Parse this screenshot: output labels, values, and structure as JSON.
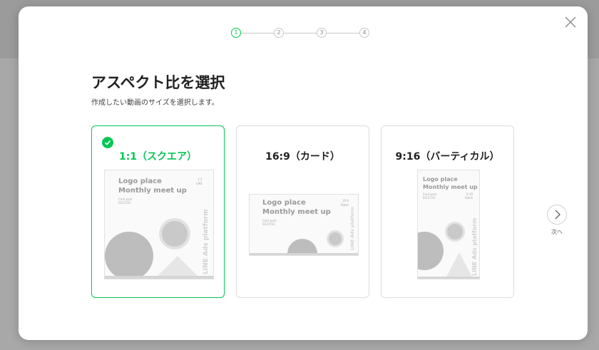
{
  "dialog": {
    "title": "アスペクト比を選択",
    "subtitle": "作成したい動画のサイズを選択します。",
    "steps": [
      "1",
      "2",
      "3",
      "4"
    ],
    "active_step": 1,
    "next_label": "次へ",
    "accent_color": "#06c755"
  },
  "options": [
    {
      "label": "1:1（スクエア）",
      "selected": true,
      "preview": {
        "logo_line1": "Logo place",
        "logo_line2": "Monthly meet up",
        "small_line1": "Card park",
        "small_line2": "02/27/21",
        "corner_line1": "1:1",
        "corner_line2": "LINE",
        "side_text": "LINE Ads platform"
      }
    },
    {
      "label": "16:9（カード）",
      "selected": false,
      "preview": {
        "logo_line1": "Logo place",
        "logo_line2": "Monthly meet up",
        "small_line1": "Card park",
        "small_line2": "02/27/21",
        "corner_line1": "16:9",
        "corner_line2": "Rakki",
        "side_text": "LINE Ads platform"
      }
    },
    {
      "label": "9:16（バーティカル）",
      "selected": false,
      "preview": {
        "logo_line1": "Logo place",
        "logo_line2": "Monthly meet up",
        "small_line1": "Card park",
        "small_line2": "02/27/21",
        "corner_line1": "9:16",
        "corner_line2": "Rakki",
        "side_text": "LINE Ads platform"
      }
    }
  ]
}
